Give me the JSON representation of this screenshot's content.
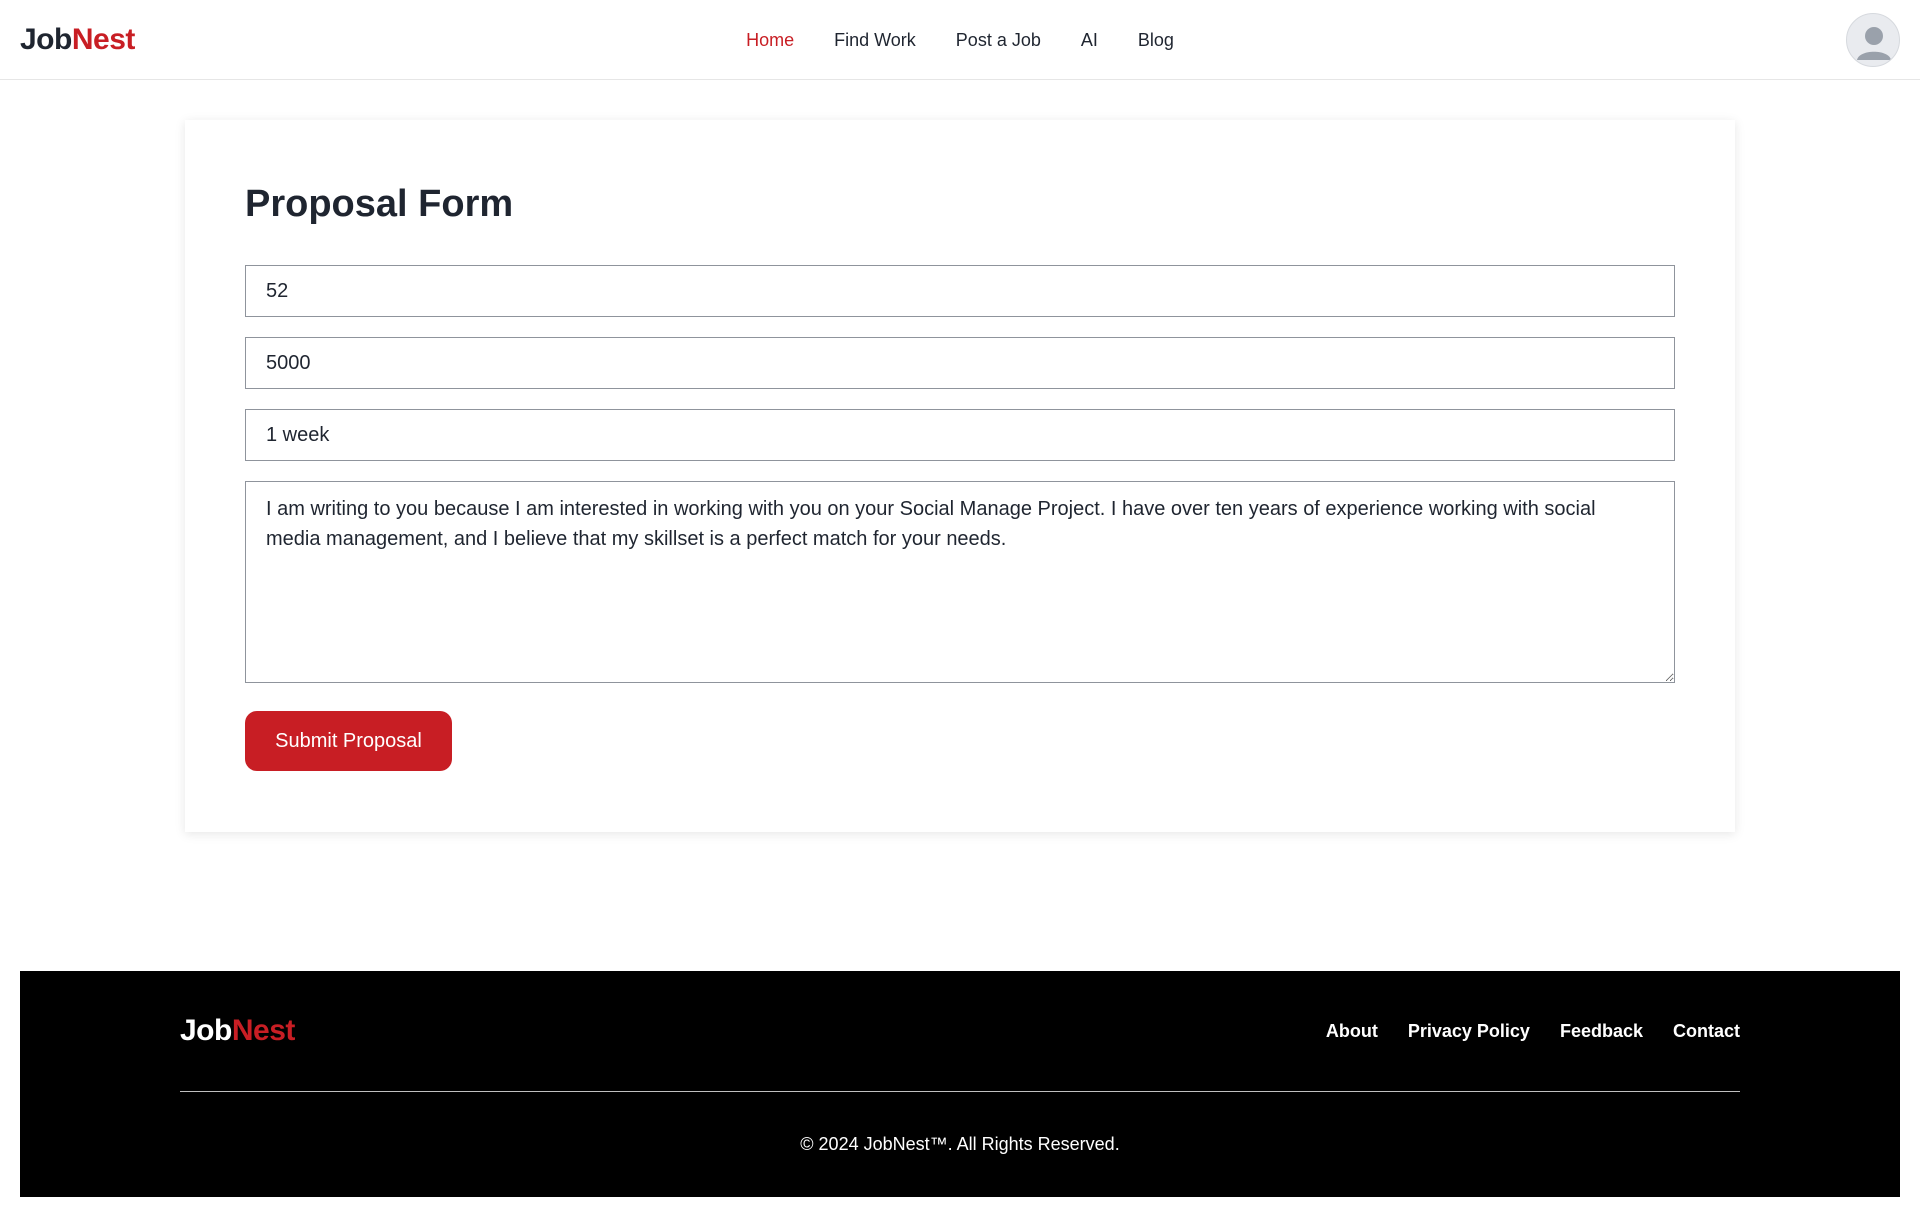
{
  "brand": {
    "part1": "Job",
    "part2": "Nest"
  },
  "nav": {
    "items": [
      {
        "label": "Home",
        "active": true
      },
      {
        "label": "Find Work",
        "active": false
      },
      {
        "label": "Post a Job",
        "active": false
      },
      {
        "label": "AI",
        "active": false
      },
      {
        "label": "Blog",
        "active": false
      }
    ]
  },
  "form": {
    "title": "Proposal Form",
    "field1_value": "52",
    "field2_value": "5000",
    "field3_value": "1 week",
    "message_value": "I am writing to you because I am interested in working with you on your Social Manage Project. I have over ten years of experience working with social media management, and I believe that my skillset is a perfect match for your needs.",
    "submit_label": "Submit Proposal"
  },
  "footer": {
    "links": [
      "About",
      "Privacy Policy",
      "Feedback",
      "Contact"
    ],
    "copyright": "© 2024 JobNest™. All Rights Reserved."
  },
  "colors": {
    "accent": "#c81e24",
    "text": "#1f2530",
    "footer_bg": "#000000"
  }
}
